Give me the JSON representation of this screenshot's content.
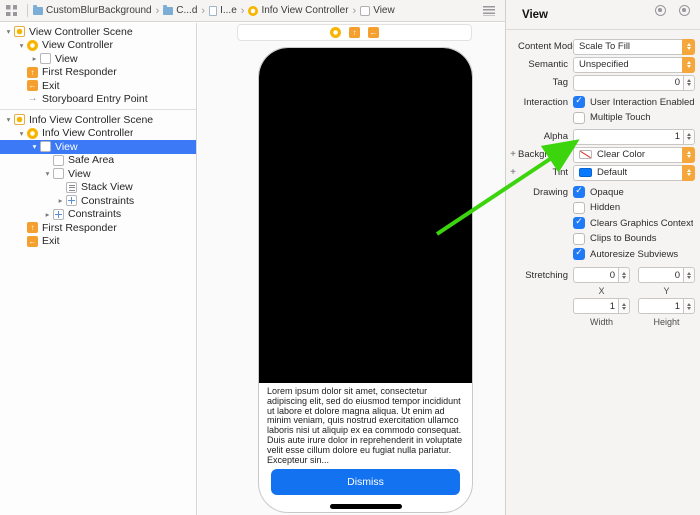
{
  "toolbar": {
    "breadcrumbs": [
      {
        "label": "CustomBlurBackground"
      },
      {
        "label": "C...d"
      },
      {
        "label": "I...e"
      },
      {
        "label": "Info View Controller"
      },
      {
        "label": "View"
      }
    ]
  },
  "sidebar": {
    "items": [
      {
        "label": "View Controller Scene"
      },
      {
        "label": "View Controller"
      },
      {
        "label": "View"
      },
      {
        "label": "First Responder"
      },
      {
        "label": "Exit"
      },
      {
        "label": "Storyboard Entry Point"
      },
      {
        "label": "Info View Controller Scene"
      },
      {
        "label": "Info View Controller"
      },
      {
        "label": "View",
        "selected": true
      },
      {
        "label": "Safe Area"
      },
      {
        "label": "View"
      },
      {
        "label": "Stack View"
      },
      {
        "label": "Constraints"
      },
      {
        "label": "Constraints"
      },
      {
        "label": "First Responder"
      },
      {
        "label": "Exit"
      }
    ]
  },
  "canvas": {
    "lorem_text": "Lorem ipsum dolor sit amet, consectetur adipiscing elit, sed do eiusmod tempor incididunt ut labore et dolore magna aliqua. Ut enim ad minim veniam, quis nostrud exercitation ullamco laboris nisi ut aliquip ex ea commodo consequat. Duis aute irure dolor in reprehenderit in voluptate velit esse cillum dolore eu fugiat nulla pariatur. Excepteur sin...",
    "dismiss_label": "Dismiss"
  },
  "inspector": {
    "title": "View",
    "content_mode": {
      "label": "Content Mode",
      "value": "Scale To Fill"
    },
    "semantic": {
      "label": "Semantic",
      "value": "Unspecified"
    },
    "tag": {
      "label": "Tag",
      "value": "0"
    },
    "interaction": {
      "label": "Interaction",
      "checkboxes": [
        {
          "label": "User Interaction Enabled",
          "checked": true
        },
        {
          "label": "Multiple Touch",
          "checked": false
        }
      ]
    },
    "alpha": {
      "label": "Alpha",
      "value": "1"
    },
    "background": {
      "label": "Background",
      "value": "Clear Color"
    },
    "tint": {
      "label": "Tint",
      "value": "Default"
    },
    "drawing": {
      "label": "Drawing",
      "checkboxes": [
        {
          "label": "Opaque",
          "checked": true
        },
        {
          "label": "Hidden",
          "checked": false
        },
        {
          "label": "Clears Graphics Context",
          "checked": true
        },
        {
          "label": "Clips to Bounds",
          "checked": false
        },
        {
          "label": "Autoresize Subviews",
          "checked": true
        }
      ]
    },
    "stretching": {
      "label": "Stretching",
      "x_value": "0",
      "y_value": "0",
      "w_value": "1",
      "h_value": "1",
      "x_label": "X",
      "y_label": "Y",
      "w_label": "Width",
      "h_label": "Height"
    }
  },
  "colors": {
    "selection_blue": "#3b79f7",
    "checkbox_blue": "#217af5",
    "popup_cap_orange": "#f5a73b",
    "dismiss_blue": "#1372f0",
    "tint_swatch_blue": "#0a7aff",
    "icon_yellow": "#f7b500",
    "icon_orange": "#f49f2e",
    "arrow_green": "#3cd40c"
  }
}
